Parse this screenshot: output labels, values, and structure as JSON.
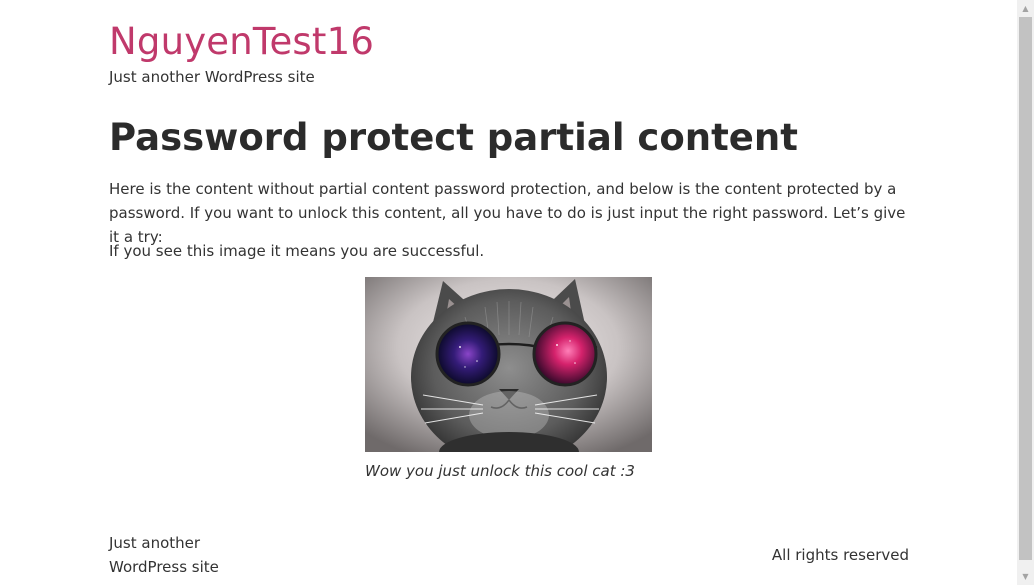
{
  "site": {
    "title": "NguyenTest16",
    "tagline": "Just another WordPress site",
    "title_color": "#c0396b"
  },
  "post": {
    "title": "Password protect partial content",
    "intro": "Here is the content without partial content password protection, and below is the content protected by a password. If you want to unlock this content, all you have to do is just input the right password. Let’s give it a try:",
    "success_text": "If you see this image it means you are successful.",
    "image_alt": "cat wearing galaxy sunglasses",
    "caption": "Wow you just unlock this cool cat :3"
  },
  "footer": {
    "tagline": "Just another WordPress site",
    "rights": "All rights reserved"
  },
  "icons": {
    "scroll_up": "scroll-up-arrow-icon",
    "scroll_down": "scroll-down-arrow-icon"
  }
}
